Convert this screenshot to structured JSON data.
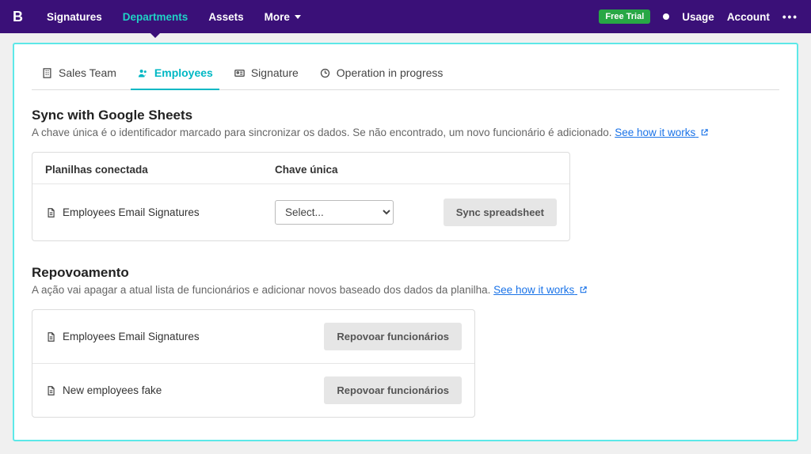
{
  "nav": {
    "logo": "B",
    "items": [
      "Signatures",
      "Departments",
      "Assets",
      "More"
    ],
    "activeIndex": 1,
    "freeTrial": "Free Trial",
    "right": [
      "Usage",
      "Account"
    ]
  },
  "tabs": {
    "items": [
      "Sales Team",
      "Employees",
      "Signature",
      "Operation in progress"
    ],
    "activeIndex": 1
  },
  "sync": {
    "title": "Sync with Google Sheets",
    "desc": "A chave única é o identificador marcado para sincronizar os dados. Se não encontrado, um novo funcionário é adicionado. ",
    "link": "See how it works",
    "colConnected": "Planilhas conectada",
    "colKey": "Chave única",
    "sheetName": "Employees Email Signatures",
    "selectPlaceholder": "Select...",
    "syncBtn": "Sync spreadsheet"
  },
  "repop": {
    "title": "Repovoamento",
    "desc": "A ação vai apagar a atual lista de funcionários e adicionar novos baseado dos dados da planilha. ",
    "link": "See how it works",
    "rows": [
      "Employees Email Signatures",
      "New employees fake"
    ],
    "btn": "Repovoar funcionários"
  }
}
